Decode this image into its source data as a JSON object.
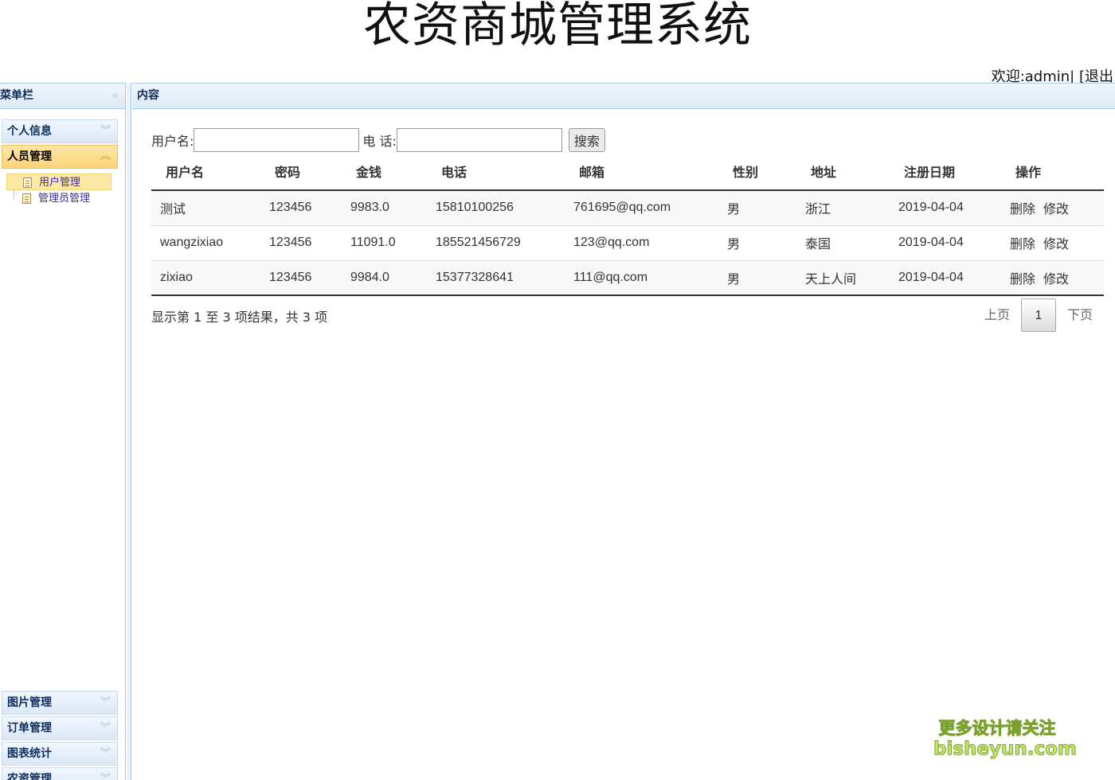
{
  "header": {
    "title": "农资商城管理系统",
    "welcome": "欢迎:admin|",
    "logout": "[退出"
  },
  "left": {
    "title": "菜单栏",
    "collapse_glyph": "«",
    "groups_top": [
      {
        "label": "个人信息",
        "active": false
      },
      {
        "label": "人员管理",
        "active": true
      }
    ],
    "tree_items": [
      {
        "label": "用户管理",
        "selected": true
      },
      {
        "label": "管理员管理",
        "selected": false
      }
    ],
    "groups_bottom": [
      {
        "label": "图片管理"
      },
      {
        "label": "订单管理"
      },
      {
        "label": "图表统计"
      },
      {
        "label": "农资管理"
      }
    ]
  },
  "content": {
    "title": "内容",
    "search": {
      "username_label": "用户名:",
      "phone_label": "电 话:",
      "button": "搜索"
    },
    "table": {
      "headers": [
        "用户名",
        "密码",
        "金钱",
        "电话",
        "邮箱",
        "性别",
        "地址",
        "注册日期",
        "操作"
      ],
      "rows": [
        {
          "username": "测试",
          "password": "123456",
          "money": "9983.0",
          "phone": "15810100256",
          "email": "761695@qq.com",
          "gender": "男",
          "address": "浙江",
          "date": "2019-04-04"
        },
        {
          "username": "wangzixiao",
          "password": "123456",
          "money": "11091.0",
          "phone": "185521456729",
          "email": "123@qq.com",
          "gender": "男",
          "address": "泰国",
          "date": "2019-04-04"
        },
        {
          "username": "zixiao",
          "password": "123456",
          "money": "9984.0",
          "phone": "15377328641",
          "email": "111@qq.com",
          "gender": "男",
          "address": "天上人间",
          "date": "2019-04-04"
        }
      ],
      "delete_label": "删除",
      "edit_label": "修改"
    },
    "info": "显示第 1 至 3 项结果，共 3 项",
    "pager": {
      "prev": "上页",
      "current": "1",
      "next": "下页"
    }
  },
  "watermark": {
    "line1": "更多设计请关注",
    "line2": "bisheyun.com"
  }
}
